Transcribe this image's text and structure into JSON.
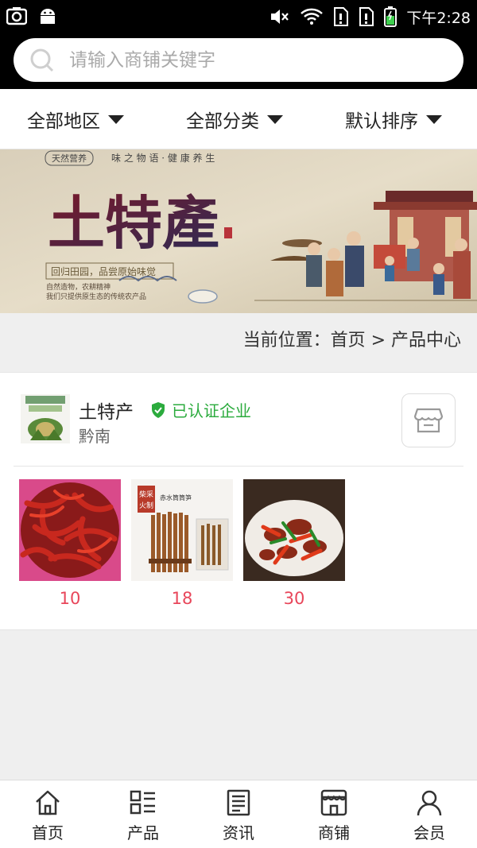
{
  "status_bar": {
    "time": "下午2:28",
    "icons": [
      "camera-icon",
      "android-icon",
      "mute-icon",
      "wifi-icon",
      "sim1-icon",
      "sim2-icon",
      "battery-icon"
    ]
  },
  "search": {
    "placeholder": "请输入商铺关键字"
  },
  "filters": [
    {
      "label": "全部地区"
    },
    {
      "label": "全部分类"
    },
    {
      "label": "默认排序"
    }
  ],
  "banner": {
    "title": "土特產",
    "tagline_top": "味 之 物 语 · 健 康 养 生",
    "seal": "天然营养",
    "slogan": "回归田园，品尝原始味觉",
    "desc_line1": "自然造物，农耕精神",
    "desc_line2": "我们只提供原生态的传统农产品"
  },
  "breadcrumb": "当前位置：首页 > 产品中心",
  "store": {
    "name": "土特产",
    "certified": "已认证企业",
    "location": "黔南",
    "products": [
      {
        "price": "10",
        "image": "dried-chili"
      },
      {
        "price": "18",
        "image": "dried-bamboo-shoots",
        "pack_label_1": "柴采",
        "pack_label_2": "火制",
        "pack_text": "赤水筒筒笋"
      },
      {
        "price": "30",
        "image": "stir-fried-meat-chili"
      }
    ]
  },
  "tabbar": [
    {
      "label": "首页",
      "icon": "home-icon"
    },
    {
      "label": "产品",
      "icon": "grid-list-icon"
    },
    {
      "label": "资讯",
      "icon": "news-icon"
    },
    {
      "label": "商铺",
      "icon": "shop-icon"
    },
    {
      "label": "会员",
      "icon": "user-icon"
    }
  ],
  "colors": {
    "header_bg": "#000000",
    "price": "#e8465a",
    "certified": "#2bab3d"
  }
}
